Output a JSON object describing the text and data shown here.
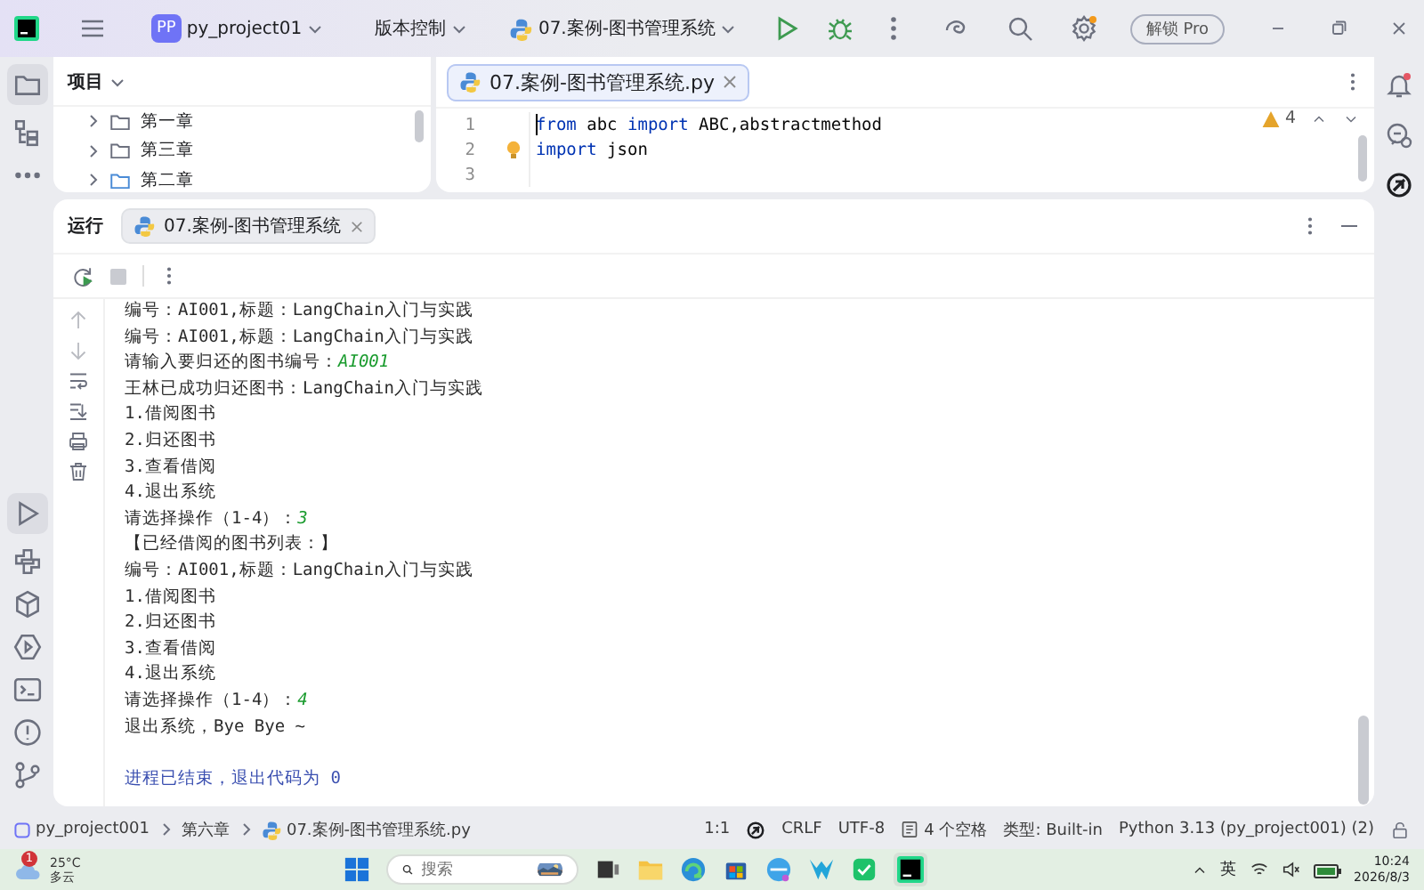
{
  "titlebar": {
    "project_badge": "PP",
    "project": "py_project01",
    "vcs": "版本控制",
    "run_config": "07.案例-图书管理系统",
    "upgrade": "解锁 Pro"
  },
  "project_panel": {
    "title": "项目",
    "items": [
      {
        "label": "第一章",
        "expanded": false
      },
      {
        "label": "第三章",
        "expanded": false
      },
      {
        "label": "第二章",
        "expanded": false
      }
    ]
  },
  "editor": {
    "tab": "07.案例-图书管理系统.py",
    "warnings": "4",
    "lines": [
      {
        "number": "1",
        "tokens": [
          {
            "text": "from",
            "kind": "keyword"
          },
          {
            "text": " abc ",
            "kind": "plain"
          },
          {
            "text": "import",
            "kind": "keyword"
          },
          {
            "text": " ABC,abstractmethod",
            "kind": "plain"
          }
        ]
      },
      {
        "number": "2",
        "tokens": [
          {
            "text": "import",
            "kind": "keyword"
          },
          {
            "text": " json",
            "kind": "plain"
          }
        ]
      },
      {
        "number": "3"
      }
    ]
  },
  "run_panel": {
    "title": "运行",
    "tab": "07.案例-图书管理系统",
    "lines": [
      {
        "kind": "output",
        "text": "编号：AI001,标题：LangChain入门与实践"
      },
      {
        "kind": "output",
        "text": "编号：AI001,标题：LangChain入门与实践"
      },
      {
        "kind": "prompt",
        "text": "请输入要归还的图书编号：",
        "input": "AI001"
      },
      {
        "kind": "output",
        "text": "王林已成功归还图书：LangChain入门与实践"
      },
      {
        "kind": "output",
        "text": "1.借阅图书"
      },
      {
        "kind": "output",
        "text": "2.归还图书"
      },
      {
        "kind": "output",
        "text": "3.查看借阅"
      },
      {
        "kind": "output",
        "text": "4.退出系统"
      },
      {
        "kind": "prompt",
        "text": "请选择操作（1-4）：",
        "input": "3"
      },
      {
        "kind": "output",
        "text": "【已经借阅的图书列表：】"
      },
      {
        "kind": "output",
        "text": "编号：AI001,标题：LangChain入门与实践"
      },
      {
        "kind": "output",
        "text": "1.借阅图书"
      },
      {
        "kind": "output",
        "text": "2.归还图书"
      },
      {
        "kind": "output",
        "text": "3.查看借阅"
      },
      {
        "kind": "output",
        "text": "4.退出系统"
      },
      {
        "kind": "prompt",
        "text": "请选择操作（1-4）：",
        "input": "4"
      },
      {
        "kind": "output",
        "text": "退出系统，Bye Bye ~"
      },
      {
        "kind": "blank"
      },
      {
        "kind": "exit",
        "text": "进程已结束，退出代码为 0"
      }
    ]
  },
  "status_bar": {
    "breadcrumbs": [
      "py_project001",
      "第六章",
      "07.案例-图书管理系统.py"
    ],
    "items": [
      {
        "kind": "plain",
        "text": "1:1"
      },
      {
        "kind": "ai"
      },
      {
        "kind": "plain",
        "text": "CRLF"
      },
      {
        "kind": "plain",
        "text": "UTF-8"
      },
      {
        "kind": "indent",
        "text": "4 个空格"
      },
      {
        "kind": "plain",
        "text": "类型: Built-in"
      },
      {
        "kind": "plain",
        "text": "Python 3.13 (py_project001) (2)"
      }
    ]
  },
  "taskbar": {
    "temperature": "25°C",
    "condition": "多云",
    "weather_badge": "1",
    "search_placeholder": "搜索",
    "ime": "英",
    "time": "10:24",
    "date": "2026/8/3"
  }
}
